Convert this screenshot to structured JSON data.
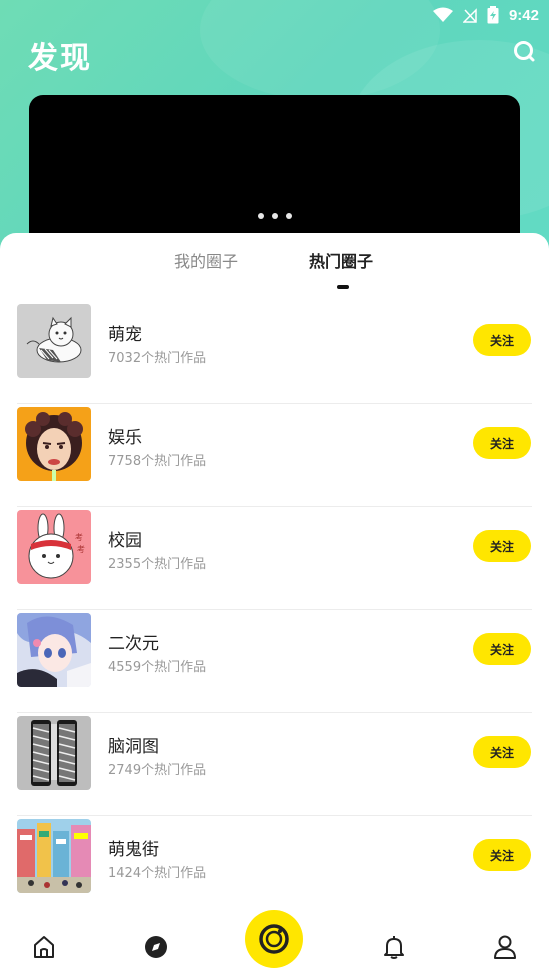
{
  "status": {
    "time": "9:42"
  },
  "header": {
    "title": "发现"
  },
  "tabs": [
    {
      "label": "我的圈子",
      "active": false
    },
    {
      "label": "热门圈子",
      "active": true
    }
  ],
  "circles": [
    {
      "title": "萌宠",
      "subtitle": "7032个热门作品",
      "follow_label": "关注",
      "thumb": "cat-thumbnail"
    },
    {
      "title": "娱乐",
      "subtitle": "7758个热门作品",
      "follow_label": "关注",
      "thumb": "face-thumbnail"
    },
    {
      "title": "校园",
      "subtitle": "2355个热门作品",
      "follow_label": "关注",
      "thumb": "rabbit-thumbnail"
    },
    {
      "title": "二次元",
      "subtitle": "4559个热门作品",
      "follow_label": "关注",
      "thumb": "anime-thumbnail"
    },
    {
      "title": "脑洞图",
      "subtitle": "2749个热门作品",
      "follow_label": "关注",
      "thumb": "pattern-thumbnail"
    },
    {
      "title": "萌鬼街",
      "subtitle": "1424个热门作品",
      "follow_label": "关注",
      "thumb": "street-thumbnail"
    }
  ],
  "colors": {
    "accent": "#ffe600",
    "header": "#5fd6bd"
  },
  "nav": [
    "home-icon",
    "discover-icon",
    "camera-icon",
    "bell-icon",
    "profile-icon"
  ]
}
